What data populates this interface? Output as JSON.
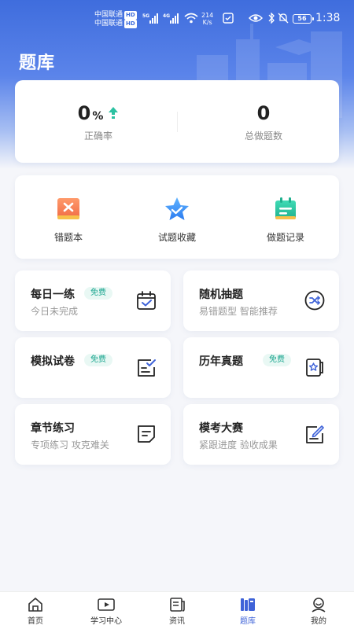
{
  "status_bar": {
    "carrier1": "中国联通",
    "carrier2": "中国联通",
    "hd": "HD",
    "net1": "5G",
    "net2": "4G",
    "speed_value": "214",
    "speed_unit": "K/s",
    "battery": "56",
    "time": "1:38"
  },
  "header": {
    "title": "题库"
  },
  "stats": {
    "accuracy_value": "0",
    "accuracy_unit": "%",
    "accuracy_label": "正确率",
    "total_value": "0",
    "total_label": "总做题数"
  },
  "quick_actions": [
    {
      "label": "错题本",
      "icon": "wrong-book-icon"
    },
    {
      "label": "试题收藏",
      "icon": "star-favorite-icon"
    },
    {
      "label": "做题记录",
      "icon": "calendar-record-icon"
    }
  ],
  "tiles": [
    {
      "title": "每日一练",
      "badge": "免费",
      "subtitle": "今日未完成",
      "icon": "calendar-check-icon"
    },
    {
      "title": "随机抽题",
      "badge": "",
      "subtitle": "易错题型 智能推荐",
      "icon": "shuffle-icon"
    },
    {
      "title": "模拟试卷",
      "badge": "免费",
      "subtitle": "",
      "icon": "exam-paper-icon"
    },
    {
      "title": "历年真题",
      "badge": "免费",
      "subtitle": "",
      "icon": "past-paper-icon"
    },
    {
      "title": "章节练习",
      "badge": "",
      "subtitle": "专项练习 攻克难关",
      "icon": "chapter-note-icon"
    },
    {
      "title": "模考大赛",
      "badge": "",
      "subtitle": "紧跟进度 验收成果",
      "icon": "contest-edit-icon"
    }
  ],
  "tabbar": {
    "items": [
      {
        "label": "首页",
        "icon": "home-icon"
      },
      {
        "label": "学习中心",
        "icon": "video-play-icon"
      },
      {
        "label": "资讯",
        "icon": "news-icon"
      },
      {
        "label": "题库",
        "icon": "question-bank-icon"
      },
      {
        "label": "我的",
        "icon": "profile-icon"
      }
    ],
    "active": "题库"
  },
  "colors": {
    "primary": "#3f63d8",
    "accent_green": "#1aa58f",
    "badge_bg": "#e9f8f4",
    "orange": "#f06b45",
    "teal": "#2bc1a1"
  }
}
